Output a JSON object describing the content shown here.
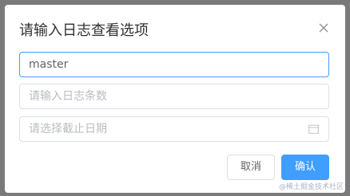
{
  "dialog": {
    "title": "请输入日志查看选项",
    "close_icon": "close-icon",
    "branch_input": {
      "value": "master",
      "placeholder": ""
    },
    "count_input": {
      "value": "",
      "placeholder": "请输入日志条数"
    },
    "date_input": {
      "value": "",
      "placeholder": "请选择截止日期",
      "icon": "calendar-icon"
    },
    "cancel_label": "取消",
    "confirm_label": "确认"
  },
  "watermark": "@稀土掘金技术社区",
  "colors": {
    "accent": "#409eff",
    "overlay": "#7a7a7a",
    "border": "#dcdfe6",
    "placeholder": "#b9bcc2",
    "text": "#303133"
  }
}
